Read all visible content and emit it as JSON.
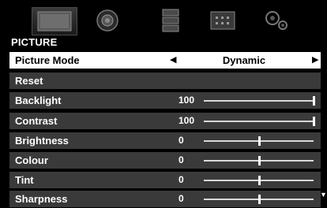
{
  "tabs": [
    {
      "icon": "picture-icon",
      "active": true
    },
    {
      "icon": "sound-icon",
      "active": false
    },
    {
      "icon": "settings-icon",
      "active": false
    },
    {
      "icon": "apps-icon",
      "active": false
    },
    {
      "icon": "setup-icon",
      "active": false
    }
  ],
  "section_title": "PICTURE",
  "picture_mode": {
    "label": "Picture Mode",
    "value": "Dynamic"
  },
  "reset": {
    "label": "Reset"
  },
  "settings": [
    {
      "label": "Backlight",
      "value": "100",
      "level": 1.0
    },
    {
      "label": "Contrast",
      "value": "100",
      "level": 1.0
    },
    {
      "label": "Brightness",
      "value": "0",
      "level": 0.5
    },
    {
      "label": "Colour",
      "value": "0",
      "level": 0.5
    },
    {
      "label": "Tint",
      "value": "0",
      "level": 0.5
    },
    {
      "label": "Sharpness",
      "value": "0",
      "level": 0.5
    }
  ],
  "colors": {
    "row_bg": "#3a3a3a",
    "selected_bg": "#ffffff",
    "background": "#000000"
  }
}
